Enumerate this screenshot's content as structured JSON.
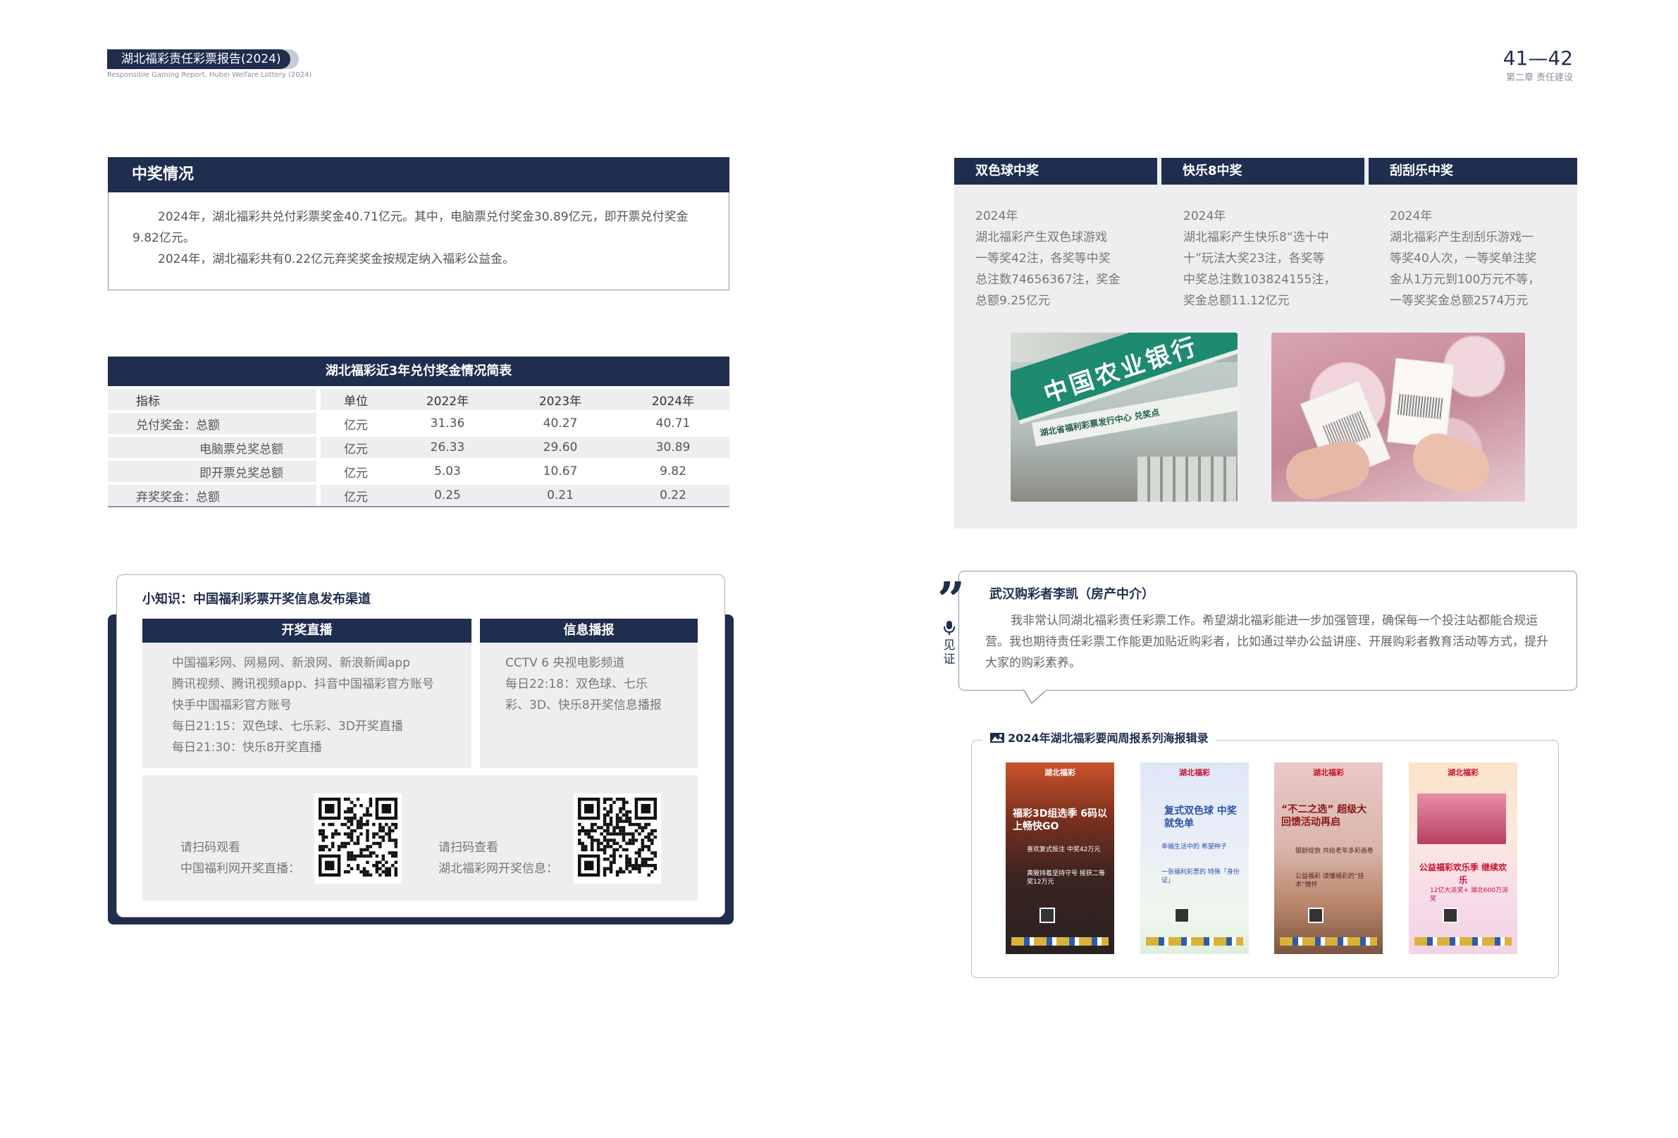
{
  "header": {
    "report_title": "湖北福彩责任彩票报告(2024)",
    "report_subtitle": "Responsible Gaming Report, Hubei Welfare Lottery (2024)",
    "page_numbers": "41—42",
    "chapter": "第二章 责任建设"
  },
  "winning": {
    "title": "中奖情况",
    "para1": "2024年，湖北福彩共兑付彩票奖金40.71亿元。其中，电脑票兑付奖金30.89亿元，即开票兑付奖金9.82亿元。",
    "para2": "2024年，湖北福彩共有0.22亿元弃奖奖金按规定纳入福彩公益金。"
  },
  "prize_table": {
    "title": "湖北福彩近3年兑付奖金情况简表",
    "headers": [
      "指标",
      "单位",
      "2022年",
      "2023年",
      "2024年"
    ],
    "rows": [
      {
        "label": "兑付奖金：总额",
        "unit": "亿元",
        "v2022": "31.36",
        "v2023": "40.27",
        "v2024": "40.71"
      },
      {
        "label": "电脑票兑奖总额",
        "unit": "亿元",
        "v2022": "26.33",
        "v2023": "29.60",
        "v2024": "30.89"
      },
      {
        "label": "即开票兑奖总额",
        "unit": "亿元",
        "v2022": "5.03",
        "v2023": "10.67",
        "v2024": "9.82"
      },
      {
        "label": "弃奖奖金：总额",
        "unit": "亿元",
        "v2022": "0.25",
        "v2023": "0.21",
        "v2024": "0.22"
      }
    ]
  },
  "knowledge": {
    "title": "小知识：中国福利彩票开奖信息发布渠道",
    "live_header": "开奖直播",
    "info_header": "信息播报",
    "live_lines": [
      "中国福彩网、网易网、新浪网、新浪新闻app",
      "腾讯视频、腾讯视频app、抖音中国福彩官方账号",
      "快手中国福彩官方账号",
      "每日21:15：双色球、七乐彩、3D开奖直播",
      "每日21:30：快乐8开奖直播"
    ],
    "info_lines": [
      "CCTV 6 央视电影频道",
      "每日22:18：双色球、七乐",
      "彩、3D、快乐8开奖信息播报"
    ],
    "qr1_caption_1": "请扫码观看",
    "qr1_caption_2": "中国福利网开奖直播：",
    "qr2_caption_1": "请扫码查看",
    "qr2_caption_2": "湖北福彩网开奖信息："
  },
  "games": [
    {
      "title": "双色球中奖",
      "lines": [
        "2024年",
        "湖北福彩产生双色球游戏",
        "一等奖42注，各奖等中奖",
        "总注数74656367注，奖金",
        "总额9.25亿元"
      ]
    },
    {
      "title": "快乐8中奖",
      "lines": [
        "2024年",
        "湖北福彩产生快乐8“选十中",
        "十”玩法大奖23注，各奖等",
        "中奖总注数103824155注，",
        "奖金总额11.12亿元"
      ]
    },
    {
      "title": "刮刮乐中奖",
      "lines": [
        "2024年",
        "湖北福彩产生刮刮乐游戏一",
        "等奖40人次，一等奖单注奖",
        "金从1万元到100万元不等，",
        "一等奖奖金总额2574万元"
      ]
    }
  ],
  "photo1": {
    "sign_main": "中国农业银行",
    "sign_sub": "湖北省福利彩票发行中心 兑奖点"
  },
  "quote": {
    "side_label": "见证",
    "name": "武汉购彩者李凯（房产中介）",
    "text": "我非常认同湖北福彩责任彩票工作。希望湖北福彩能进一步加强管理，确保每一个投注站都能合规运营。我也期待责任彩票工作能更加贴近购彩者，比如通过举办公益讲座、开展购彩者教育活动等方式，提升大家的购彩素养。"
  },
  "gallery": {
    "title": "2024年湖北福彩要闻周报系列海报辑录",
    "posters": [
      {
        "logo": "湖北福彩",
        "headline": "福彩3D组选季 6码以上畅快GO",
        "items": [
          "喜欢复式投注 中奖42万元",
          "黄陂持着坚持守号 摇获二等奖12万元"
        ]
      },
      {
        "logo": "湖北福彩",
        "headline": "复式双色球 中奖就免单",
        "items": [
          "幸福生活中的 希望种子",
          "一张福利彩票的 特殊「身份证」"
        ]
      },
      {
        "logo": "湖北福彩",
        "headline": "“不二之选” 超级大回馈活动再启",
        "items": [
          "银龄绽放 共绘老年多彩画卷",
          "公益福彩 读懂福彩的“技术”情怀"
        ]
      },
      {
        "logo": "湖北福彩",
        "headline": "公益福彩欢乐季 继续欢乐",
        "items": [
          "12亿大派奖+ 湖北600万派奖"
        ]
      }
    ]
  },
  "colors": {
    "navy": "#1f2d4e",
    "panel_gray": "#eeeef1",
    "text_gray": "#777777"
  }
}
